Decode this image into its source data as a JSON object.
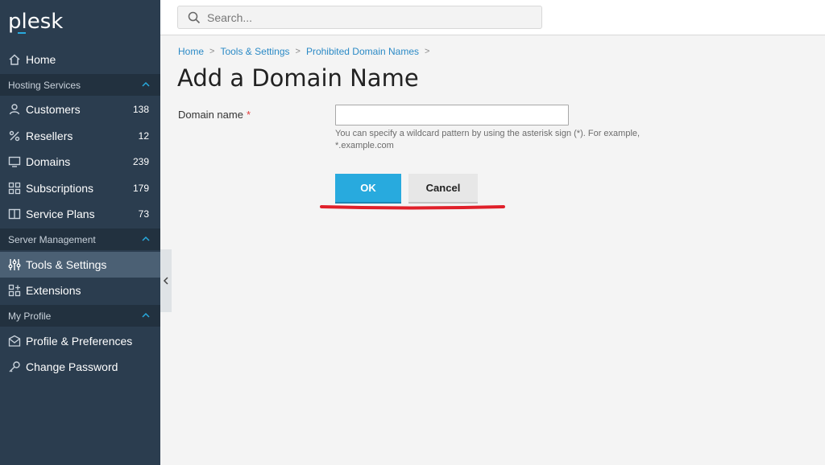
{
  "app": {
    "logo_text": "plesk",
    "accent": "#28aade",
    "sidebar_bg": "#2b3d4f"
  },
  "sidebar": {
    "home": {
      "label": "Home",
      "icon": "home-icon"
    },
    "sections": [
      {
        "label": "Hosting Services",
        "expanded": true
      },
      {
        "label": "Server Management",
        "expanded": true
      },
      {
        "label": "My Profile",
        "expanded": true
      }
    ],
    "hosting_items": [
      {
        "label": "Customers",
        "count": "138",
        "icon": "user-icon"
      },
      {
        "label": "Resellers",
        "count": "12",
        "icon": "percent-icon"
      },
      {
        "label": "Domains",
        "count": "239",
        "icon": "monitor-icon"
      },
      {
        "label": "Subscriptions",
        "count": "179",
        "icon": "grid-icon"
      },
      {
        "label": "Service Plans",
        "count": "73",
        "icon": "book-icon"
      }
    ],
    "server_items": [
      {
        "label": "Tools & Settings",
        "icon": "sliders-icon",
        "active": true
      },
      {
        "label": "Extensions",
        "icon": "extensions-icon"
      }
    ],
    "profile_items": [
      {
        "label": "Profile & Preferences",
        "icon": "profile-icon"
      },
      {
        "label": "Change Password",
        "icon": "key-icon"
      }
    ]
  },
  "search": {
    "placeholder": "Search..."
  },
  "breadcrumb": [
    "Home",
    "Tools & Settings",
    "Prohibited Domain Names"
  ],
  "page": {
    "title": "Add a Domain Name"
  },
  "form": {
    "domain_label": "Domain name",
    "required_mark": "*",
    "domain_value": "",
    "hint": "You can specify a wildcard pattern by using the asterisk sign (*). For example, *.example.com"
  },
  "buttons": {
    "ok": "OK",
    "cancel": "Cancel"
  },
  "annotation_color": "#e0202a"
}
